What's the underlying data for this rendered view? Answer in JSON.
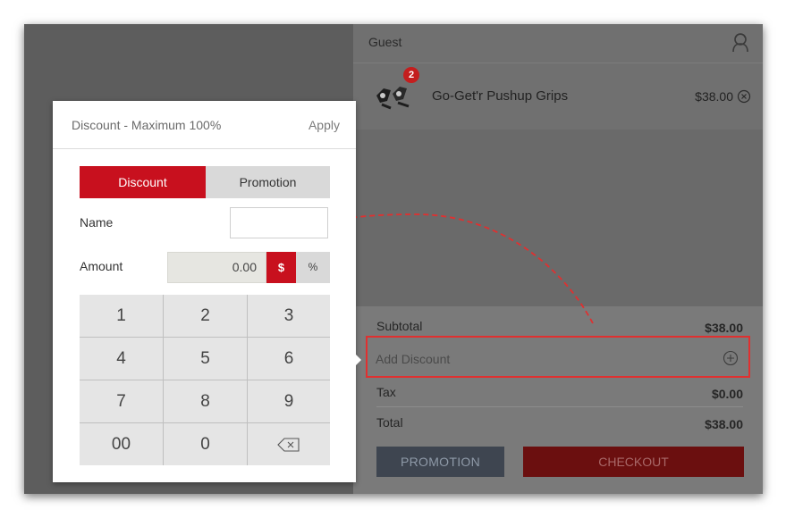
{
  "cart": {
    "customer_label": "Guest",
    "items": [
      {
        "name": "Go-Get'r Pushup Grips",
        "price": "$38.00",
        "quantity": "2"
      }
    ],
    "totals": {
      "subtotal_label": "Subtotal",
      "subtotal_value": "$38.00",
      "add_discount_label": "Add Discount",
      "tax_label": "Tax",
      "tax_value": "$0.00",
      "total_label": "Total",
      "total_value": "$38.00"
    },
    "promotion_button": "PROMOTION",
    "checkout_button": "CHECKOUT"
  },
  "discount_popup": {
    "title": "Discount - Maximum 100%",
    "apply_label": "Apply",
    "tabs": [
      "Discount",
      "Promotion"
    ],
    "active_tab": "Discount",
    "name_label": "Name",
    "name_value": "",
    "amount_label": "Amount",
    "amount_value": "0.00",
    "currency_dollar": "$",
    "currency_percent": "%",
    "keypad": [
      "1",
      "2",
      "3",
      "4",
      "5",
      "6",
      "7",
      "8",
      "9",
      "00",
      "0"
    ]
  },
  "colors": {
    "accent_red": "#c8101e",
    "highlight_red": "#e03030",
    "background_overlay": "#5d5d5d"
  },
  "icons": {
    "customer": "customer-profile-icon",
    "remove_item": "remove-circle-icon",
    "add_discount": "add-circle-icon",
    "backspace": "backspace-icon",
    "product": "pushup-grips-product-icon"
  }
}
